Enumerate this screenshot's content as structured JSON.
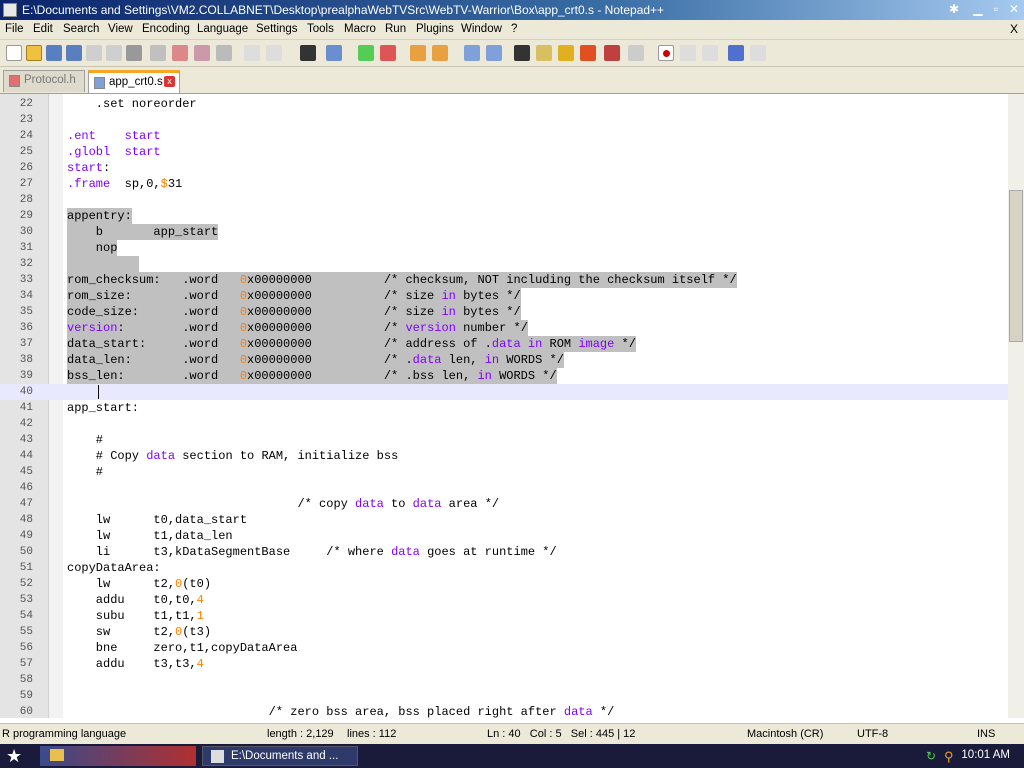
{
  "window": {
    "title": "E:\\Documents and Settings\\VM2.COLLABNET\\Desktop\\prealphaWebTVSrc\\WebTV-Warrior\\Box\\app_crt0.s - Notepad++"
  },
  "menu": [
    "File",
    "Edit",
    "Search",
    "View",
    "Encoding",
    "Language",
    "Settings",
    "Tools",
    "Macro",
    "Run",
    "Plugins",
    "Window",
    "?"
  ],
  "menu_close": "X",
  "tabs": [
    {
      "label": "Protocol.h",
      "active": false
    },
    {
      "label": "app_crt0.s",
      "active": true
    }
  ],
  "code": [
    {
      "n": "22",
      "t": "    .set noreorder"
    },
    {
      "n": "23",
      "t": ""
    },
    {
      "n": "24",
      "t": ".ent    start"
    },
    {
      "n": "25",
      "t": ".globl  start"
    },
    {
      "n": "26",
      "t": "start:"
    },
    {
      "n": "27",
      "t": ".frame  sp,0,$31"
    },
    {
      "n": "28",
      "t": ""
    },
    {
      "n": "29",
      "t": "appentry:"
    },
    {
      "n": "30",
      "t": "    b       app_start"
    },
    {
      "n": "31",
      "t": "    nop"
    },
    {
      "n": "32",
      "t": ""
    },
    {
      "n": "33",
      "t": "rom_checksum:   .word   0x00000000          /* checksum, NOT including the checksum itself */"
    },
    {
      "n": "34",
      "t": "rom_size:       .word   0x00000000          /* size in bytes */"
    },
    {
      "n": "35",
      "t": "code_size:      .word   0x00000000          /* size in bytes */"
    },
    {
      "n": "36",
      "t": "version:        .word   0x00000000          /* version number */"
    },
    {
      "n": "37",
      "t": "data_start:     .word   0x00000000          /* address of .data in ROM image */"
    },
    {
      "n": "38",
      "t": "data_len:       .word   0x00000000          /* .data len, in WORDS */"
    },
    {
      "n": "39",
      "t": "bss_len:        .word   0x00000000          /* .bss len, in WORDS */"
    },
    {
      "n": "40",
      "t": ""
    },
    {
      "n": "41",
      "t": "app_start:"
    },
    {
      "n": "42",
      "t": ""
    },
    {
      "n": "43",
      "t": "    #"
    },
    {
      "n": "44",
      "t": "    # Copy data section to RAM, initialize bss"
    },
    {
      "n": "45",
      "t": "    #"
    },
    {
      "n": "46",
      "t": ""
    },
    {
      "n": "47",
      "t": "                                /* copy data to data area */"
    },
    {
      "n": "48",
      "t": "    lw      t0,data_start"
    },
    {
      "n": "49",
      "t": "    lw      t1,data_len"
    },
    {
      "n": "50",
      "t": "    li      t3,kDataSegmentBase     /* where data goes at runtime */"
    },
    {
      "n": "51",
      "t": "copyDataArea:"
    },
    {
      "n": "52",
      "t": "    lw      t2,0(t0)"
    },
    {
      "n": "53",
      "t": "    addu    t0,t0,4"
    },
    {
      "n": "54",
      "t": "    subu    t1,t1,1"
    },
    {
      "n": "55",
      "t": "    sw      t2,0(t3)"
    },
    {
      "n": "56",
      "t": "    bne     zero,t1,copyDataArea"
    },
    {
      "n": "57",
      "t": "    addu    t3,t3,4"
    },
    {
      "n": "58",
      "t": ""
    },
    {
      "n": "59",
      "t": ""
    },
    {
      "n": "60",
      "t": "                            /* zero bss area, bss placed right after data */"
    }
  ],
  "status": {
    "language": "R programming language",
    "length": "length : 2,129",
    "lines": "lines : 112",
    "position": "Ln : 40   Col : 5   Sel : 445 | 12",
    "eol": "Macintosh (CR)",
    "encoding": "UTF-8",
    "mode": "INS"
  },
  "taskbar": {
    "button1": "E:\\Documents and ...",
    "clock": "10:01 AM"
  },
  "colors": {
    "keyword": "#8000ff",
    "number": "#ff8000",
    "selection": "#c0c0c0",
    "caret_line": "#e8e8ff"
  }
}
